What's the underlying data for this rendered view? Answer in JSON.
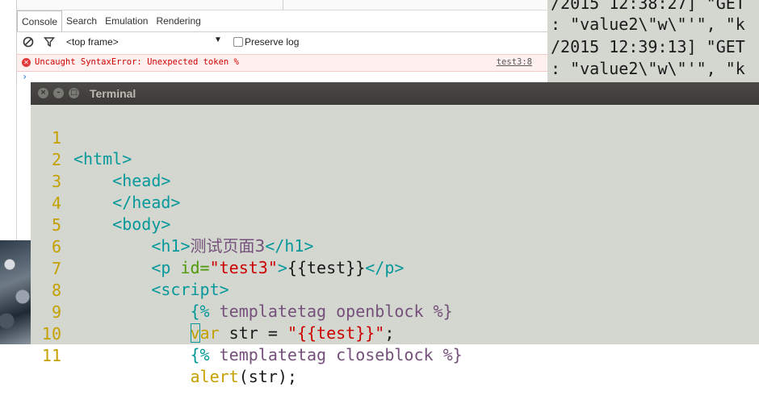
{
  "devtools": {
    "tabs": [
      "Console",
      "Search",
      "Emulation",
      "Rendering"
    ],
    "frame_select": "<top frame>",
    "preserve_log_label": "Preserve log",
    "error_message": "Uncaught SyntaxError: Unexpected token %",
    "error_source": "test3:8",
    "prompt_symbol": "›"
  },
  "background_terminal": {
    "lines": [
      "/2015 12:38:27] \"GET",
      ": \"value2\\\"w\\\"'\", \"k",
      "/2015 12:39:13] \"GET",
      ": \"value2\\\"w\\\"'\", \"k"
    ]
  },
  "terminal": {
    "title": "Terminal",
    "line_numbers": [
      "1",
      "2",
      "3",
      "4",
      "5",
      "6",
      "7",
      "8",
      "9",
      "10",
      "11"
    ],
    "code": {
      "l1": "<html>",
      "l2": "<head>",
      "l3": "</head>",
      "l4": "<body>",
      "l5_open": "<h1>",
      "l5_text": "测试页面3",
      "l5_close": "</h1>",
      "l6_open": "<p ",
      "l6_attr": "id=",
      "l6_val": "\"test3\"",
      "l6_gt": ">",
      "l6_text": "{{test}}",
      "l6_close": "</p>",
      "l7": "<script>",
      "l8_brace": "{%",
      "l8_text": " templatetag openblock ",
      "l8_end": "%}",
      "l9_cursor": "v",
      "l9_kw": "ar",
      "l9_mid": " str = ",
      "l9_str": "\"{{test}}\"",
      "l9_end": ";",
      "l10_brace": "{%",
      "l10_text": " templatetag closeblock ",
      "l10_end": "%}",
      "l11_kw": "alert",
      "l11_rest": "(str);"
    }
  },
  "colors": {
    "terminal_bg": "#d3d7cf",
    "line_number": "#c4a000",
    "tag": "#06989a",
    "string": "#cc0000",
    "error": "#d10000"
  }
}
